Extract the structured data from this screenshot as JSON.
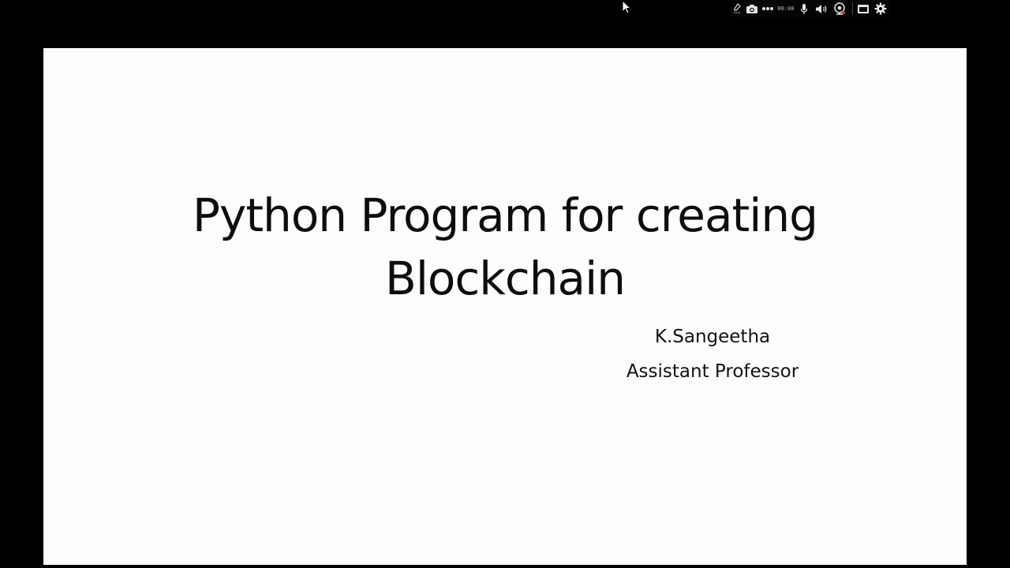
{
  "slide": {
    "title_line1": "Python Program for creating",
    "title_line2": "Blockchain",
    "author_name": "K.Sangeetha",
    "author_role": "Assistant Professor"
  },
  "recorder_toolbar": {
    "timer": "00:00",
    "icons": [
      "pen-icon",
      "camera-icon",
      "more-dots-icon",
      "microphone-icon",
      "speaker-icon",
      "webcam-icon",
      "window-icon",
      "gear-icon"
    ]
  },
  "colors": {
    "background": "#000000",
    "slide": "#fdfdfd",
    "text": "#0d0d0d"
  }
}
